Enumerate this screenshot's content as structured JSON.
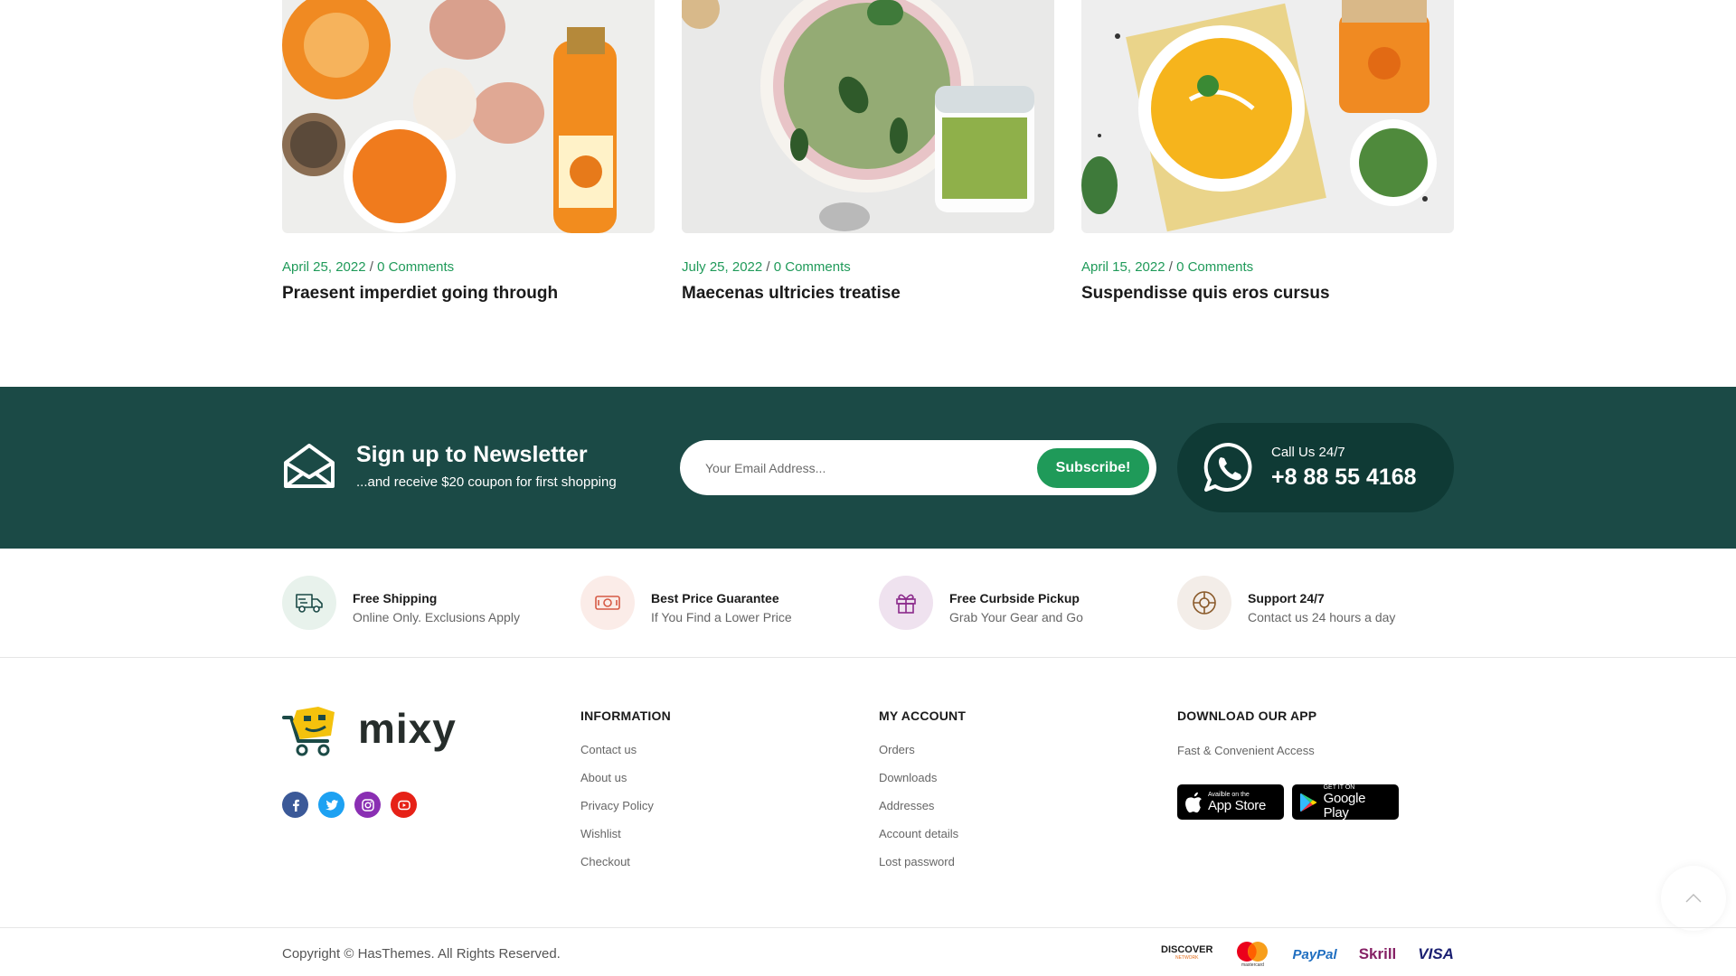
{
  "blog": {
    "posts": [
      {
        "date": "April 25, 2022",
        "separator": "/",
        "comments": "0 Comments",
        "title": "Praesent imperdiet going through",
        "image_icon": "pumpkin-juice-photo"
      },
      {
        "date": "July 25, 2022",
        "separator": "/",
        "comments": "0 Comments",
        "title": "Maecenas ultricies treatise",
        "image_icon": "zucchini-soup-photo"
      },
      {
        "date": "April 15, 2022",
        "separator": "/",
        "comments": "0 Comments",
        "title": "Suspendisse quis eros cursus",
        "image_icon": "pumpkin-soup-photo"
      }
    ]
  },
  "newsletter": {
    "title": "Sign up to Newsletter",
    "subtitle": "...and receive $20 coupon for first shopping",
    "email_placeholder": "Your Email Address...",
    "subscribe_label": "Subscribe!",
    "call_label": "Call Us 24/7",
    "call_number": "+8 88 55 4168",
    "bg_color": "#1b4a46",
    "accent_color": "#1f9a59"
  },
  "features": [
    {
      "title": "Free Shipping",
      "subtitle": "Online Only. Exclusions Apply",
      "icon": "truck-icon"
    },
    {
      "title": "Best Price Guarantee",
      "subtitle": "If You Find a Lower Price",
      "icon": "money-icon"
    },
    {
      "title": "Free Curbside Pickup",
      "subtitle": "Grab Your Gear and Go",
      "icon": "gift-icon"
    },
    {
      "title": "Support 24/7",
      "subtitle": "Contact us 24 hours a day",
      "icon": "lifebuoy-icon"
    }
  ],
  "footer": {
    "logo_text": "mixy",
    "socials": [
      "facebook-icon",
      "twitter-icon",
      "instagram-icon",
      "youtube-icon"
    ],
    "information": {
      "heading": "INFORMATION",
      "links": [
        "Contact us",
        "About us",
        "Privacy Policy",
        "Wishlist",
        "Checkout"
      ]
    },
    "account": {
      "heading": "MY ACCOUNT",
      "links": [
        "Orders",
        "Downloads",
        "Addresses",
        "Account details",
        "Lost password"
      ]
    },
    "app": {
      "heading": "DOWNLOAD OUR APP",
      "subtitle": "Fast & Convenient Access",
      "appstore_small": "Availble on the",
      "appstore_big": "App Store",
      "googleplay_small": "GET IT ON",
      "googleplay_big": "Google Play"
    }
  },
  "bottom": {
    "copyright": "Copyright © HasThemes. All Rights Reserved.",
    "payments": {
      "discover": "DISCOVER",
      "discover_sub": "NETWORK",
      "mastercard": "mastercard",
      "paypal": "PayPal",
      "skrill": "Skrill",
      "visa": "VISA"
    }
  }
}
